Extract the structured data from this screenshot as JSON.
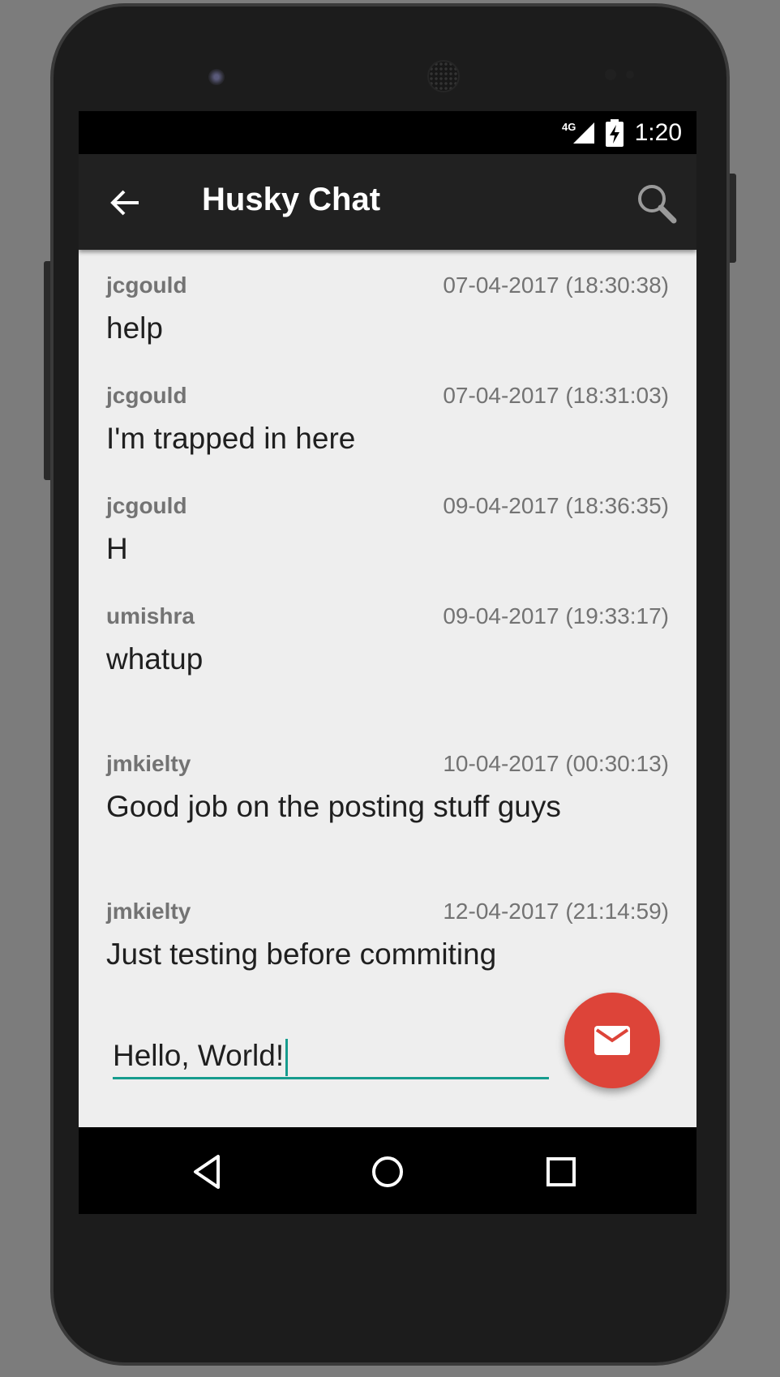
{
  "status_bar": {
    "network_label": "4G",
    "time": "1:20",
    "icons": [
      "signal-icon",
      "battery-charging-icon"
    ]
  },
  "app_bar": {
    "title": "Husky Chat",
    "icons": [
      "back-arrow-icon",
      "search-icon"
    ]
  },
  "messages": [
    {
      "user": "jcgould",
      "timestamp": "07-04-2017 (18:30:38)",
      "text": "help"
    },
    {
      "user": "jcgould",
      "timestamp": "07-04-2017 (18:31:03)",
      "text": "I'm trapped in here"
    },
    {
      "user": "jcgould",
      "timestamp": "09-04-2017 (18:36:35)",
      "text": "H"
    },
    {
      "user": "umishra",
      "timestamp": "09-04-2017 (19:33:17)",
      "text": "whatup"
    },
    {
      "user": "jmkielty",
      "timestamp": "10-04-2017 (00:30:13)",
      "text": "Good job on the posting stuff guys"
    },
    {
      "user": "jmkielty",
      "timestamp": "12-04-2017 (21:14:59)",
      "text": "Just testing before commiting"
    }
  ],
  "composer": {
    "value": "Hello, World!",
    "send_icon": "email-icon"
  },
  "nav_bar": {
    "icons": [
      "nav-back-icon",
      "nav-home-icon",
      "nav-recents-icon"
    ]
  },
  "colors": {
    "accent": "#169c8e",
    "fab": "#dd4439",
    "app_bar": "#212121",
    "content_bg": "#eeeeee"
  }
}
